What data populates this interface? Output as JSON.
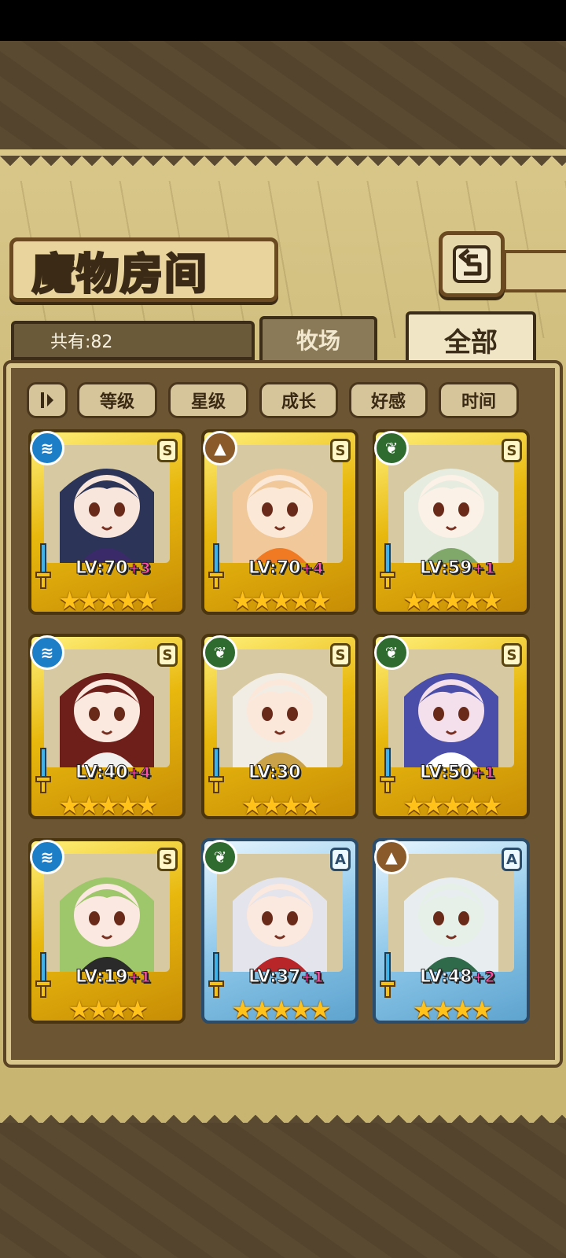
{
  "header": {
    "title": "魔物房间"
  },
  "tabs": [
    {
      "label": "牧场",
      "active": false
    },
    {
      "label": "全部",
      "active": true
    }
  ],
  "count_label": "共有:82",
  "sort_buttons": [
    "等级",
    "星级",
    "成长",
    "好感",
    "时间"
  ],
  "cards": [
    {
      "element": "water",
      "rank": "S",
      "frame": "gold",
      "level": "LV:70",
      "plus": "+3",
      "stars": "★★★★★",
      "hair": "#2c3558",
      "skin": "#f8e6dc",
      "accent": "#3a2a6a"
    },
    {
      "element": "earth",
      "rank": "S",
      "frame": "gold",
      "level": "LV:70",
      "plus": "+4",
      "stars": "★★★★★",
      "hair": "#f0c89a",
      "skin": "#fbe8d6",
      "accent": "#f07a24"
    },
    {
      "element": "wood",
      "rank": "S",
      "frame": "gold",
      "level": "LV:59",
      "plus": "+1",
      "stars": "★★★★★",
      "hair": "#e6ecdf",
      "skin": "#fbf1e6",
      "accent": "#7fa86a"
    },
    {
      "element": "water",
      "rank": "S",
      "frame": "gold",
      "level": "LV:40",
      "plus": "+4",
      "stars": "★★★★★",
      "hair": "#6e1f1a",
      "skin": "#fbe8de",
      "accent": "#f2f0ee"
    },
    {
      "element": "wood",
      "rank": "S",
      "frame": "gold",
      "level": "LV:30",
      "plus": "",
      "stars": "★★★★",
      "hair": "#f2ede4",
      "skin": "#fbe8da",
      "accent": "#c9a24a"
    },
    {
      "element": "wood",
      "rank": "S",
      "frame": "gold",
      "level": "LV:50",
      "plus": "+1",
      "stars": "★★★★★",
      "hair": "#4a4ea8",
      "skin": "#f4e0ec",
      "accent": "#ffffff"
    },
    {
      "element": "water",
      "rank": "S",
      "frame": "gold",
      "level": "LV:19",
      "plus": "+1",
      "stars": "★★★★",
      "hair": "#9dc76a",
      "skin": "#fbe8e0",
      "accent": "#2a2a2a"
    },
    {
      "element": "wood",
      "rank": "A",
      "frame": "blue",
      "level": "LV:37",
      "plus": "+1",
      "stars": "★★★★★",
      "hair": "#e4e4ec",
      "skin": "#fbe8de",
      "accent": "#b8262a"
    },
    {
      "element": "earth",
      "rank": "A",
      "frame": "blue",
      "level": "LV:48",
      "plus": "+2",
      "stars": "★★★★",
      "hair": "#e8eef0",
      "skin": "#e6f0e8",
      "accent": "#2f6a4a"
    }
  ],
  "icons": {
    "back": "back-arrow-icon",
    "sort_toggle": "sort-order-icon",
    "water": "water-element-icon",
    "wood": "leaf-element-icon",
    "earth": "mountain-element-icon",
    "weapon": "sword-icon"
  }
}
